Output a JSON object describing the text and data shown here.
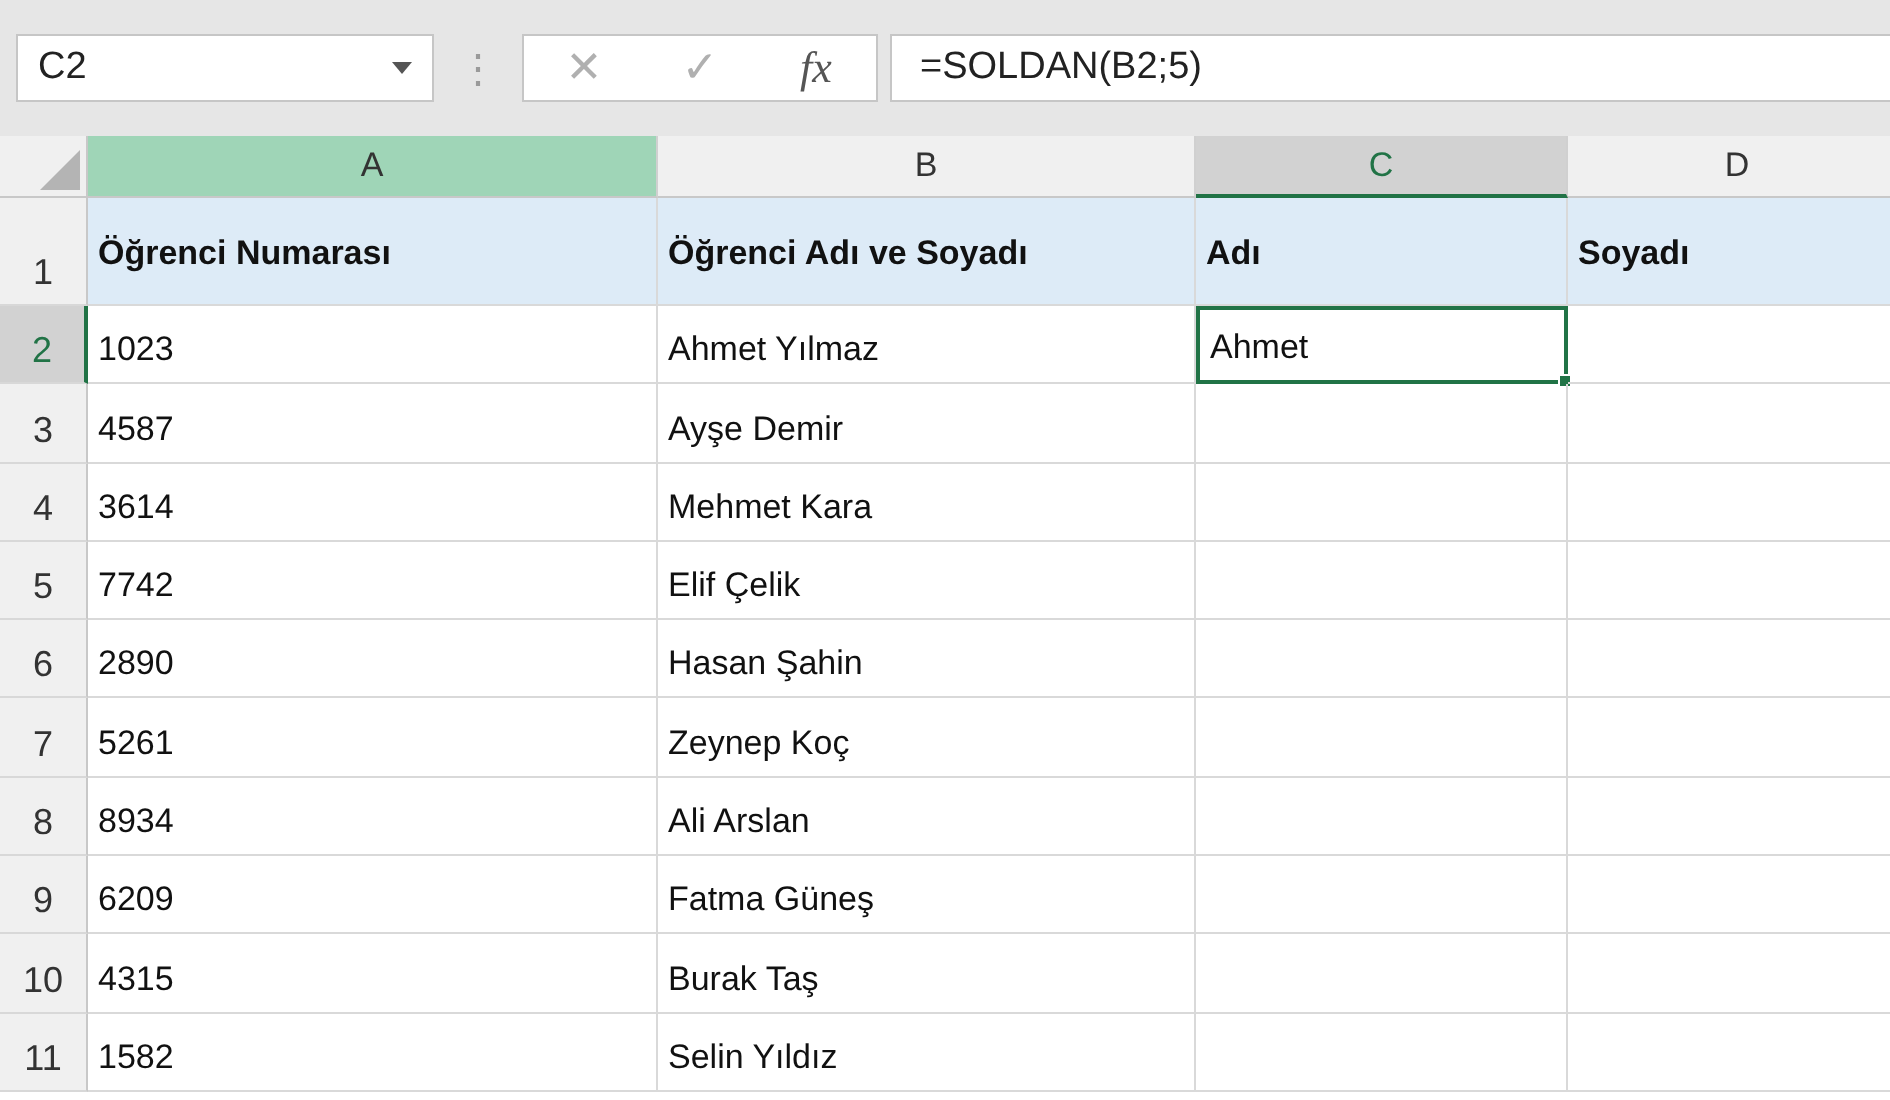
{
  "formula_bar": {
    "name_box": "C2",
    "separator": "⋮",
    "cancel": "✕",
    "enter": "✓",
    "function": "fx",
    "formula": "=SOLDAN(B2;5)"
  },
  "sheet": {
    "columns": [
      {
        "label": "A",
        "kind": "highlighted"
      },
      {
        "label": "B",
        "kind": "plain"
      },
      {
        "label": "C",
        "kind": "active"
      },
      {
        "label": "D",
        "kind": "plain"
      }
    ],
    "header_row": {
      "number": "1",
      "cells": [
        "Öğrenci Numarası",
        "Öğrenci Adı ve Soyadı",
        "Adı",
        "Soyadı"
      ]
    },
    "rows": [
      {
        "number": "2",
        "active": true,
        "cells": [
          "1023",
          "Ahmet Yılmaz",
          "Ahmet"
        ]
      },
      {
        "number": "3",
        "active": false,
        "cells": [
          "4587",
          "Ayşe Demir"
        ]
      },
      {
        "number": "4",
        "active": false,
        "cells": [
          "3614",
          "Mehmet Kara"
        ]
      },
      {
        "number": "5",
        "active": false,
        "cells": [
          "7742",
          "Elif Çelik"
        ]
      },
      {
        "number": "6",
        "active": false,
        "cells": [
          "2890",
          "Hasan Şahin"
        ]
      },
      {
        "number": "7",
        "active": false,
        "cells": [
          "5261",
          "Zeynep Koç"
        ]
      },
      {
        "number": "8",
        "active": false,
        "cells": [
          "8934",
          "Ali Arslan"
        ]
      },
      {
        "number": "9",
        "active": false,
        "cells": [
          "6209",
          "Fatma Güneş"
        ]
      },
      {
        "number": "10",
        "active": false,
        "cells": [
          "4315",
          "Burak Taş"
        ]
      },
      {
        "number": "11",
        "active": false,
        "cells": [
          "1582",
          "Selin Yıldız"
        ]
      }
    ]
  }
}
